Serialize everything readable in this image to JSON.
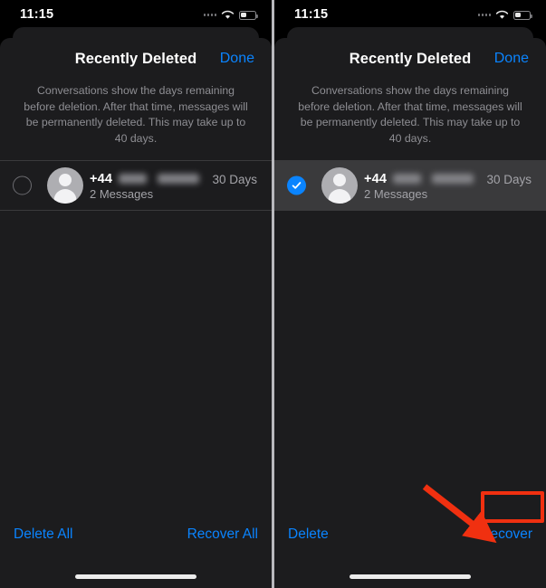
{
  "status_bar": {
    "time": "11:15",
    "signal_icon": "signal-dots-icon",
    "wifi_icon": "wifi-icon",
    "battery_icon": "battery-icon"
  },
  "nav": {
    "title": "Recently Deleted",
    "done_label": "Done"
  },
  "description": "Conversations show the days remaining before deletion. After that time, messages will be permanently deleted. This may take up to 40 days.",
  "conversation": {
    "country_code": "+44",
    "phone_number_redacted": true,
    "message_count": "2 Messages",
    "days_remaining": "30 Days",
    "avatar_icon": "person-avatar-icon"
  },
  "panels": [
    {
      "id": "left",
      "selected": false,
      "selection_icon": "empty-circle-icon",
      "toolbar": {
        "left_label": "Delete All",
        "right_label": "Recover All"
      }
    },
    {
      "id": "right",
      "selected": true,
      "selection_icon": "blue-checkmark-circle-icon",
      "toolbar": {
        "left_label": "Delete",
        "right_label": "Recover"
      },
      "annotation": {
        "highlight_target": "Recover",
        "arrow_icon": "red-arrow-icon"
      }
    }
  ],
  "colors": {
    "accent_blue": "#0a84ff",
    "annotation_red": "#f03010",
    "sheet_bg": "#1c1c1e",
    "selected_row_bg": "#3a3a3c",
    "secondary_text": "#8e8e93",
    "screen_bg": "#000000"
  }
}
